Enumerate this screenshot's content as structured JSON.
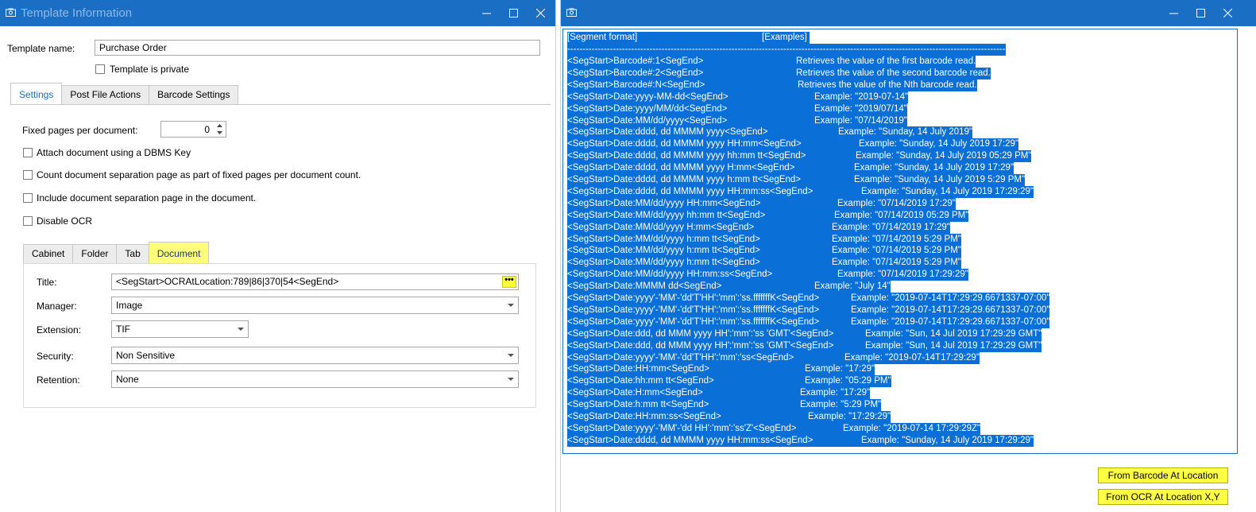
{
  "left_window": {
    "title": "Template Information",
    "template_name_label": "Template name:",
    "template_name_value": "Purchase Order",
    "template_private_label": "Template is private",
    "tabs": [
      "Settings",
      "Post File Actions",
      "Barcode Settings"
    ],
    "fixed_pages_label": "Fixed pages per document:",
    "fixed_pages_value": "0",
    "checkboxes": [
      "Attach document using a DBMS Key",
      "Count document separation page as part of fixed pages per document count.",
      "Include document separation page in the document.",
      "Disable OCR"
    ],
    "doc_tabs": [
      "Cabinet",
      "Folder",
      "Tab",
      "Document"
    ],
    "fields": {
      "title_label": "Title:",
      "title_value": "<SegStart>OCRAtLocation:789|86|370|54<SegEnd>",
      "title_button": "•••",
      "manager_label": "Manager:",
      "manager_value": "Image",
      "extension_label": "Extension:",
      "extension_value": "TIF",
      "security_label": "Security:",
      "security_value": "Non Sensitive",
      "retention_label": "Retention:",
      "retention_value": "None"
    }
  },
  "right_window": {
    "header_format": "[Segment format]",
    "header_examples": "[Examples]",
    "divider": "------------------------------------------------------------------------------------------------------------------------------------------------------------------------",
    "rows": [
      {
        "fmt": "<SegStart>Barcode#:1<SegEnd>",
        "ex": "Retrieves the value of the first barcode read."
      },
      {
        "fmt": "<SegStart>Barcode#:2<SegEnd>",
        "ex": "Retrieves the value of the second barcode read."
      },
      {
        "fmt": "<SegStart>Barcode#:N<SegEnd>",
        "ex": "Retrieves the value of the Nth barcode read."
      },
      {
        "fmt": "<SegStart>Date:yyyy-MM-dd<SegEnd>",
        "ex": "Example: \"2019-07-14\""
      },
      {
        "fmt": "<SegStart>Date:yyyy/MM/dd<SegEnd>",
        "ex": "Example: \"2019/07/14\""
      },
      {
        "fmt": "<SegStart>Date:MM/dd/yyyy<SegEnd>",
        "ex": "Example: \"07/14/2019\""
      },
      {
        "fmt": "<SegStart>Date:dddd, dd MMMM yyyy<SegEnd>",
        "ex": "Example: \"Sunday, 14 July 2019\""
      },
      {
        "fmt": "<SegStart>Date:dddd, dd MMMM yyyy HH:mm<SegEnd>",
        "ex": "Example: \"Sunday, 14 July 2019 17:29\""
      },
      {
        "fmt": "<SegStart>Date:dddd, dd MMMM yyyy hh:mm tt<SegEnd>",
        "ex": "Example: \"Sunday, 14 July 2019 05:29 PM\""
      },
      {
        "fmt": "<SegStart>Date:dddd, dd MMMM yyyy H:mm<SegEnd>",
        "ex": "Example: \"Sunday, 14 July 2019 17:29\""
      },
      {
        "fmt": "<SegStart>Date:dddd, dd MMMM yyyy h:mm tt<SegEnd>",
        "ex": "Example: \"Sunday, 14 July 2019 5:29 PM\""
      },
      {
        "fmt": "<SegStart>Date:dddd, dd MMMM yyyy HH:mm:ss<SegEnd>",
        "ex": "Example: \"Sunday, 14 July 2019 17:29:29\""
      },
      {
        "fmt": "<SegStart>Date:MM/dd/yyyy HH:mm<SegEnd>",
        "ex": "Example: \"07/14/2019 17:29\""
      },
      {
        "fmt": "<SegStart>Date:MM/dd/yyyy hh:mm tt<SegEnd>",
        "ex": "Example: \"07/14/2019 05:29 PM\""
      },
      {
        "fmt": "<SegStart>Date:MM/dd/yyyy H:mm<SegEnd>",
        "ex": "Example: \"07/14/2019 17:29\""
      },
      {
        "fmt": "<SegStart>Date:MM/dd/yyyy h:mm tt<SegEnd>",
        "ex": "Example: \"07/14/2019 5:29 PM\""
      },
      {
        "fmt": "<SegStart>Date:MM/dd/yyyy h:mm tt<SegEnd>",
        "ex": "Example: \"07/14/2019 5:29 PM\""
      },
      {
        "fmt": "<SegStart>Date:MM/dd/yyyy h:mm tt<SegEnd>",
        "ex": "Example: \"07/14/2019 5:29 PM\""
      },
      {
        "fmt": "<SegStart>Date:MM/dd/yyyy HH:mm:ss<SegEnd>",
        "ex": "Example: \"07/14/2019 17:29:29\""
      },
      {
        "fmt": "<SegStart>Date:MMMM dd<SegEnd>",
        "ex": "Example: \"July 14\""
      },
      {
        "fmt": "<SegStart>Date:yyyy'-'MM'-'dd'T'HH':'mm':'ss.fffffffK<SegEnd>",
        "ex": "Example: \"2019-07-14T17:29:29.6671337-07:00\""
      },
      {
        "fmt": "<SegStart>Date:yyyy'-'MM'-'dd'T'HH':'mm':'ss.fffffffK<SegEnd>",
        "ex": "Example: \"2019-07-14T17:29:29.6671337-07:00\""
      },
      {
        "fmt": "<SegStart>Date:yyyy'-'MM'-'dd'T'HH':'mm':'ss.fffffffK<SegEnd>",
        "ex": "Example: \"2019-07-14T17:29:29.6671337-07:00\""
      },
      {
        "fmt": "<SegStart>Date:ddd, dd MMM yyyy HH':'mm':'ss 'GMT'<SegEnd>",
        "ex": "Example: \"Sun, 14 Jul 2019 17:29:29 GMT\""
      },
      {
        "fmt": "<SegStart>Date:ddd, dd MMM yyyy HH':'mm':'ss 'GMT'<SegEnd>",
        "ex": "Example: \"Sun, 14 Jul 2019 17:29:29 GMT\""
      },
      {
        "fmt": "<SegStart>Date:yyyy'-'MM'-'dd'T'HH':'mm':'ss<SegEnd>",
        "ex": "Example: \"2019-07-14T17:29:29\""
      },
      {
        "fmt": "<SegStart>Date:HH:mm<SegEnd>",
        "ex": "Example: \"17:29\""
      },
      {
        "fmt": "<SegStart>Date:hh:mm tt<SegEnd>",
        "ex": "Example: \"05:29 PM\""
      },
      {
        "fmt": "<SegStart>Date:H:mm<SegEnd>",
        "ex": "Example: \"17:29\""
      },
      {
        "fmt": "<SegStart>Date:h:mm tt<SegEnd>",
        "ex": "Example: \"5:29 PM\""
      },
      {
        "fmt": "<SegStart>Date:HH:mm:ss<SegEnd>",
        "ex": "Example: \"17:29:29\""
      },
      {
        "fmt": "<SegStart>Date:yyyy'-'MM'-'dd HH':'mm':'ss'Z'<SegEnd>",
        "ex": "Example: \"2019-07-14 17:29:29Z\""
      },
      {
        "fmt": "<SegStart>Date:dddd, dd MMMM yyyy HH:mm:ss<SegEnd>",
        "ex": "Example: \"Sunday, 14 July 2019 17:29:29\""
      }
    ],
    "buttons": {
      "from_barcode": "From Barcode At Location",
      "from_ocr": "From OCR At Location X,Y"
    }
  },
  "colors": {
    "titlebar": "#1a6fc4",
    "selection": "#0a6fd6",
    "highlight_yellow": "#ffff46"
  }
}
